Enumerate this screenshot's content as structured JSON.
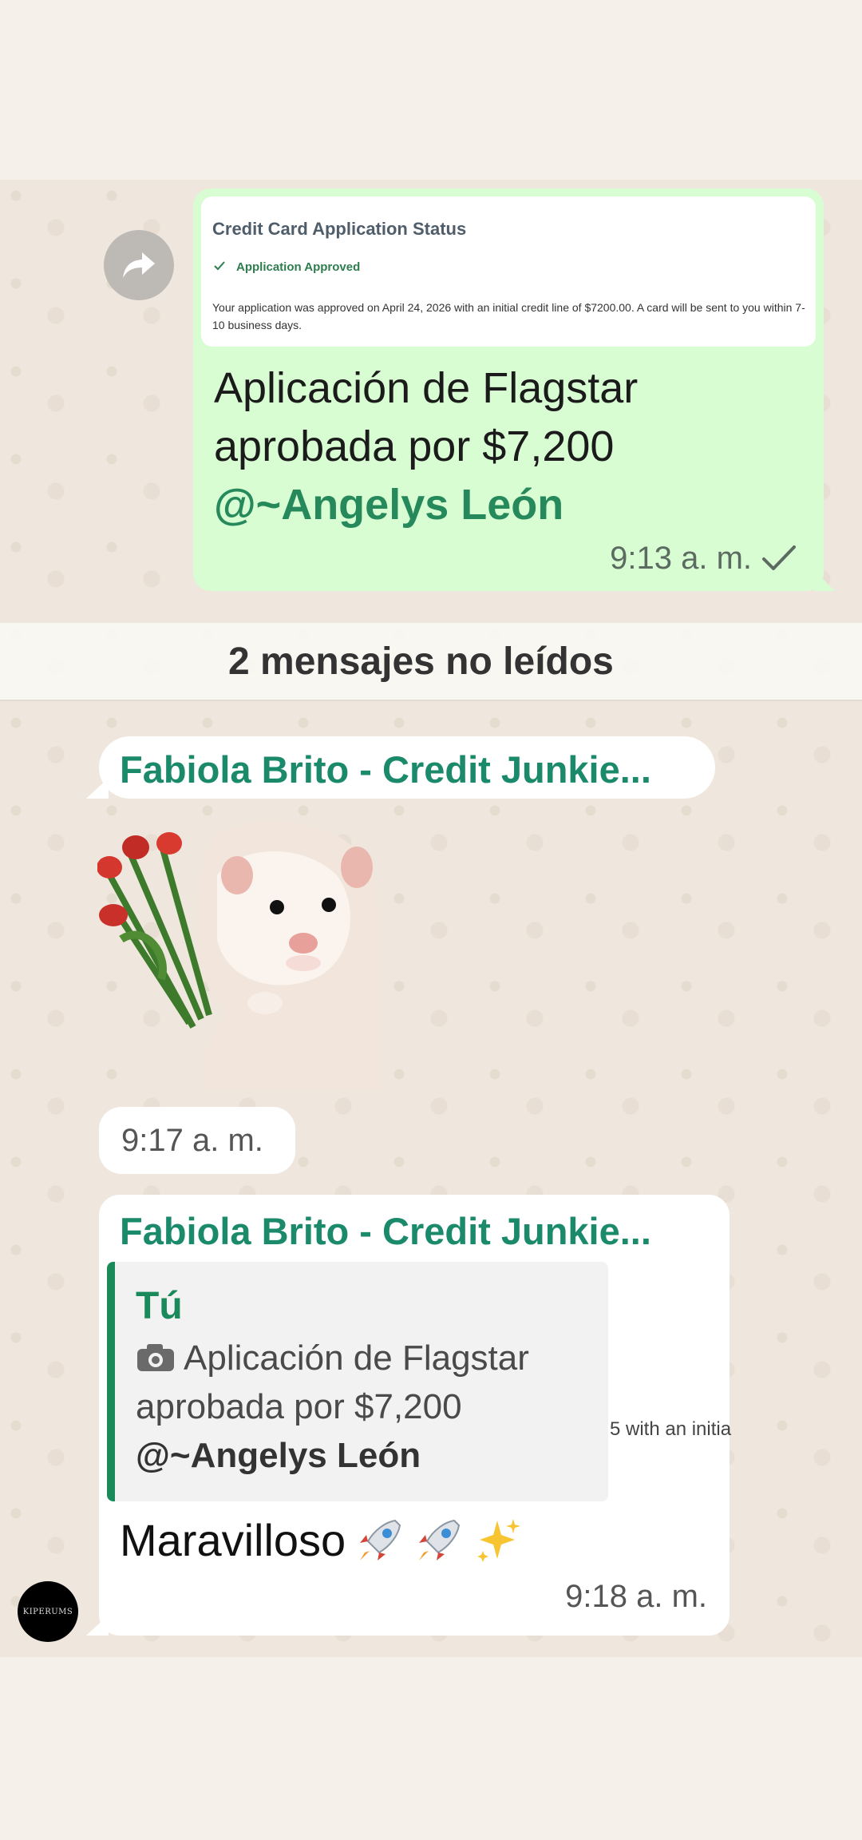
{
  "outgoing": {
    "preview_card": {
      "title": "Credit Card Application Status",
      "status": "Application Approved",
      "body": "Your application was approved on April 24, 2026 with an initial credit line of $7200.00. A card will be sent to you within 7-10 business days."
    },
    "text_line1": "Aplicación de Flagstar",
    "text_line2": "aprobada por $7,200",
    "mention": "@~Angelys León",
    "time": "9:13 a. m.",
    "status_icon": "check-icon"
  },
  "unread_divider": "2 mensajes no leídos",
  "incoming_sticker": {
    "sender": "Fabiola Brito - Credit Junkie...",
    "time": "9:17 a. m.",
    "sticker_icon": "hamster-flowers-sticker"
  },
  "incoming_reply": {
    "sender": "Fabiola Brito - Credit Junkie...",
    "quote_author": "Tú",
    "quote_line1": "Aplicación de Flagstar",
    "quote_line2": "aprobada por $7,200",
    "quote_mention": "@~Angelys León",
    "quote_thumb_text": "5 with an initia",
    "text": "Maravilloso",
    "emoji_icons": [
      "rocket-icon",
      "rocket-icon",
      "sparkles-icon"
    ],
    "time": "9:18 a. m."
  },
  "watermark": "KIPERUMS",
  "colors": {
    "outgoing_bubble": "#d9fdd3",
    "accent_green": "#1b8a6b",
    "chat_background": "#efe7dd"
  }
}
